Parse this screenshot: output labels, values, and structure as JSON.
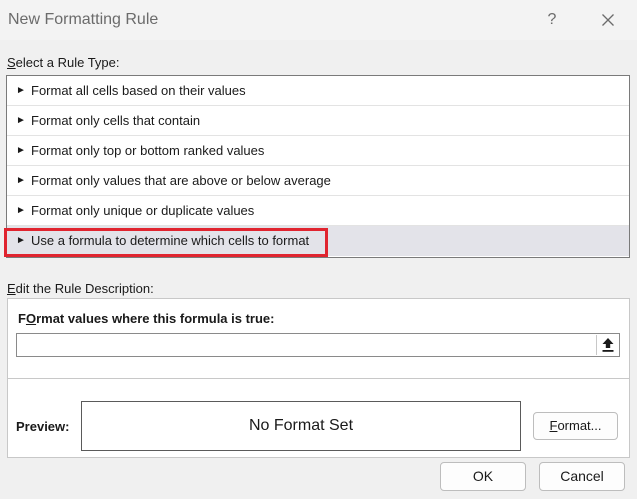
{
  "window": {
    "title": "New Formatting Rule",
    "help_glyph": "?",
    "close_glyph": "close"
  },
  "rule_type": {
    "label_accel": "S",
    "label_rest": "elect a Rule Type:",
    "arrow_glyph": "►",
    "items": [
      {
        "label": "Format all cells based on their values"
      },
      {
        "label": "Format only cells that contain"
      },
      {
        "label": "Format only top or bottom ranked values"
      },
      {
        "label": "Format only values that are above or below average"
      },
      {
        "label": "Format only unique or duplicate values"
      },
      {
        "label": "Use a formula to determine which cells to format"
      }
    ],
    "selected_index": 5,
    "highlight_color": "#e0242f"
  },
  "rule_description": {
    "label_accel": "E",
    "label_rest": "dit the Rule Description:",
    "formula_label_accel": "O",
    "formula_label_pre": "F",
    "formula_label_rest": "rmat values where this formula is true:",
    "formula_value": "",
    "collapse_icon": "upload-arrow-icon",
    "preview_label": "Preview:",
    "preview_text": "No Format Set",
    "format_button_accel": "F",
    "format_button_rest": "ormat..."
  },
  "footer": {
    "ok_label": "OK",
    "cancel_label": "Cancel"
  }
}
